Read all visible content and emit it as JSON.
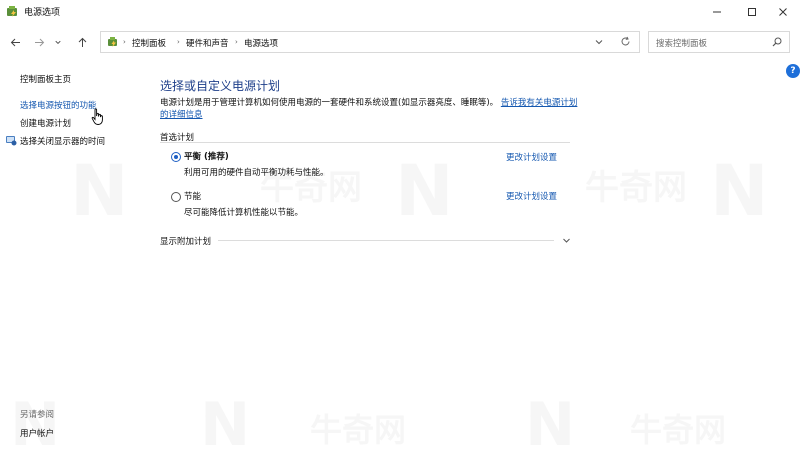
{
  "window": {
    "title": "电源选项"
  },
  "address": {
    "crumbs": [
      "控制面板",
      "硬件和声音",
      "电源选项"
    ]
  },
  "search": {
    "placeholder": "搜索控制面板"
  },
  "help": {
    "label": "?"
  },
  "sidebar": {
    "home": "控制面板主页",
    "links": [
      "选择电源按钮的功能",
      "创建电源计划",
      "选择关闭显示器的时间"
    ],
    "see_also_title": "另请参阅",
    "see_also_items": [
      "用户帐户"
    ]
  },
  "main": {
    "title": "选择或自定义电源计划",
    "description": "电源计划是用于管理计算机如何使用电源的一套硬件和系统设置(如显示器亮度、睡眠等)。",
    "description_link": "告诉我有关电源计划的详细信息",
    "preferred_label": "首选计划",
    "plans": [
      {
        "name": "平衡 (推荐)",
        "desc": "利用可用的硬件自动平衡功耗与性能。",
        "link": "更改计划设置",
        "selected": true
      },
      {
        "name": "节能",
        "desc": "尽可能降低计算机性能以节能。",
        "link": "更改计划设置",
        "selected": false
      }
    ],
    "extra_label": "显示附加计划"
  },
  "watermark": {
    "text": "牛奇网"
  }
}
